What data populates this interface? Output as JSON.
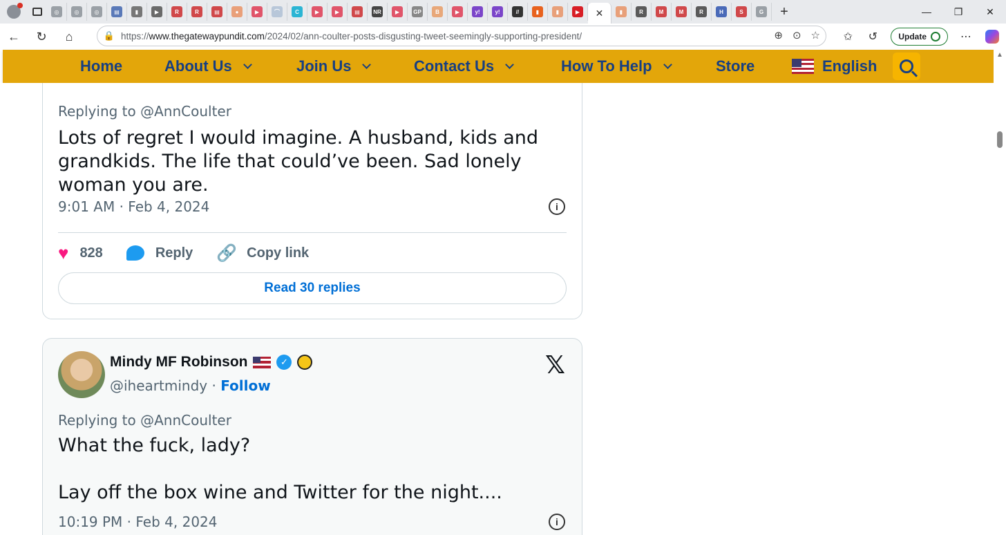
{
  "browser": {
    "url_prefix": "https://",
    "url_domain": "www.thegatewaypundit.com",
    "url_path": "/2024/02/ann-coulter-posts-disgusting-tweet-seemingly-supporting-president/",
    "update_label": "Update",
    "active_tab_close": "✕",
    "new_tab": "+",
    "tab_favicons": [
      {
        "bg": "#9aa0a6",
        "glyph": "◎"
      },
      {
        "bg": "#9aa0a6",
        "glyph": "◎"
      },
      {
        "bg": "#9aa0a6",
        "glyph": "◎"
      },
      {
        "bg": "#5a79b8",
        "glyph": "▤"
      },
      {
        "bg": "#777777",
        "glyph": "▮"
      },
      {
        "bg": "#6a6a6a",
        "glyph": "▶"
      },
      {
        "bg": "#d0484a",
        "glyph": "R"
      },
      {
        "bg": "#d0484a",
        "glyph": "R"
      },
      {
        "bg": "#d0484a",
        "glyph": "▤"
      },
      {
        "bg": "#e9a07a",
        "glyph": "●"
      },
      {
        "bg": "#e0556a",
        "glyph": "▶"
      },
      {
        "bg": "#b8c7d9",
        "glyph": "⌒"
      },
      {
        "bg": "#2bb5d4",
        "glyph": "C"
      },
      {
        "bg": "#e0556a",
        "glyph": "▶"
      },
      {
        "bg": "#e0556a",
        "glyph": "▶"
      },
      {
        "bg": "#d0484a",
        "glyph": "▤"
      },
      {
        "bg": "#444444",
        "glyph": "NR"
      },
      {
        "bg": "#e0556a",
        "glyph": "▶"
      },
      {
        "bg": "#888888",
        "glyph": "GP"
      },
      {
        "bg": "#e8a87a",
        "glyph": "B"
      },
      {
        "bg": "#e0556a",
        "glyph": "▶"
      },
      {
        "bg": "#7b45c9",
        "glyph": "y!"
      },
      {
        "bg": "#7b45c9",
        "glyph": "y!"
      },
      {
        "bg": "#333333",
        "glyph": "//"
      },
      {
        "bg": "#e8621e",
        "glyph": "▮"
      },
      {
        "bg": "#e8a07a",
        "glyph": "▮"
      },
      {
        "bg": "#d81f26",
        "glyph": "▶"
      }
    ],
    "tab_favicons_after": [
      {
        "bg": "#e8a07a",
        "glyph": "▮"
      },
      {
        "bg": "#5a5a5a",
        "glyph": "R"
      },
      {
        "bg": "#d0484a",
        "glyph": "M"
      },
      {
        "bg": "#d0484a",
        "glyph": "M"
      },
      {
        "bg": "#5a5a5a",
        "glyph": "R"
      },
      {
        "bg": "#4a6ab8",
        "glyph": "H"
      },
      {
        "bg": "#d0484a",
        "glyph": "S"
      },
      {
        "bg": "#9aa0a6",
        "glyph": "G"
      }
    ]
  },
  "nav": {
    "home": "Home",
    "about": "About Us",
    "join": "Join Us",
    "contact": "Contact Us",
    "help": "How To Help",
    "store": "Store",
    "language": "English"
  },
  "tweet1": {
    "replying": "Replying to @AnnCoulter",
    "text": "Lots of regret I would imagine. A husband, kids and grandkids. The life that could’ve been. Sad lonely woman you are.",
    "date": "9:01 AM · Feb 4, 2024",
    "likes": "828",
    "reply_label": "Reply",
    "copy_label": "Copy link",
    "read_replies": "Read 30 replies"
  },
  "tweet2": {
    "name": "Mindy MF Robinson",
    "handle": "@iheartmindy",
    "separator": " · ",
    "follow": "Follow",
    "replying": "Replying to @AnnCoulter",
    "line1": "What the fuck, lady?",
    "line2": "Lay off the box wine and Twitter for the night....",
    "date": "10:19 PM · Feb 4, 2024"
  },
  "colors": {
    "nav_bg": "#e3a60a",
    "nav_text": "#173f82",
    "link_blue": "#006fd6",
    "like_pink": "#f91880"
  }
}
